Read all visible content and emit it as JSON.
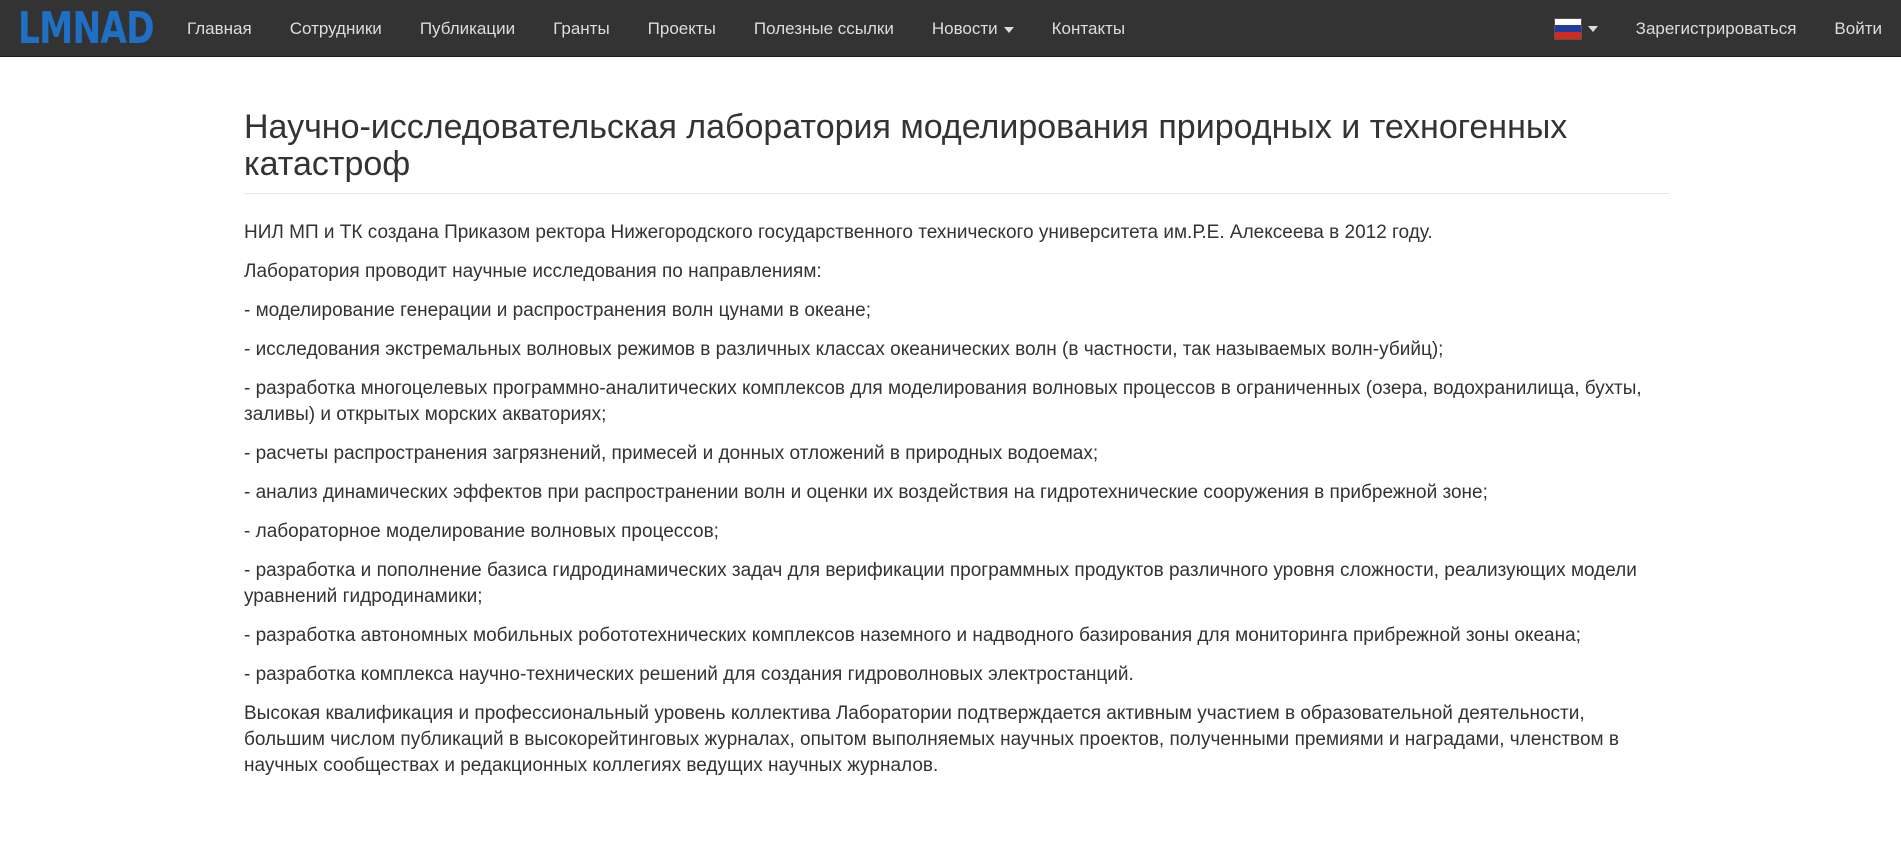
{
  "brand": {
    "logo_text": "LMNAD",
    "logo_icon": "wave-logo-icon"
  },
  "nav": {
    "items": [
      {
        "label": "Главная"
      },
      {
        "label": "Сотрудники"
      },
      {
        "label": "Публикации"
      },
      {
        "label": "Гранты"
      },
      {
        "label": "Проекты"
      },
      {
        "label": "Полезные ссылки"
      },
      {
        "label": "Новости",
        "dropdown": true
      },
      {
        "label": "Контакты"
      }
    ],
    "language_flag": "russia-flag-icon",
    "register": "Зарегистрироваться",
    "login": "Войти"
  },
  "colors": {
    "navbar_bg": "#333333",
    "nav_text": "#dddddd",
    "logo_blue": "#1f6fc4",
    "flag_white": "#ffffff",
    "flag_blue": "#1c3f9e",
    "flag_red": "#d52b1e"
  },
  "page": {
    "title": "Научно-исследовательская лаборатория моделирования природных и техногенных катастроф",
    "paragraphs": [
      "НИЛ МП и ТК создана Приказом ректора Нижегородского государственного технического университета им.Р.Е. Алексеева в 2012 году.",
      "Лаборатория проводит научные исследования по направлениям:",
      "- моделирование генерации и распространения волн цунами в океане;",
      "- исследования экстремальных волновых режимов в различных классах океанических волн (в частности, так называемых волн-убийц);",
      "- разработка многоцелевых программно-аналитических комплексов для моделирования волновых процессов в ограниченных (озера, водохранилища, бухты, заливы) и открытых морских акваториях;",
      "- расчеты распространения загрязнений, примесей и донных отложений в природных водоемах;",
      "- анализ динамических эффектов при распространении волн и оценки их воздействия на гидротехнические сооружения в прибрежной зоне;",
      "- лабораторное моделирование волновых процессов;",
      "- разработка и пополнение базиса гидродинамических задач для верификации программных продуктов различного уровня сложности, реализующих модели уравнений гидродинамики;",
      "- разработка автономных мобильных робототехнических комплексов наземного и надводного базирования для мониторинга прибрежной зоны океана;",
      "- разработка комплекса научно-технических решений для создания гидроволновых электростанций.",
      "Высокая квалификация и профессиональный уровень коллектива Лаборатории подтверждается активным участием в образовательной деятельности, большим числом публикаций в высокорейтинговых журналах, опытом выполняемых научных проектов, полученными премиями и наградами, членством в научных сообществах и редакционных коллегиях ведущих научных журналов."
    ]
  }
}
